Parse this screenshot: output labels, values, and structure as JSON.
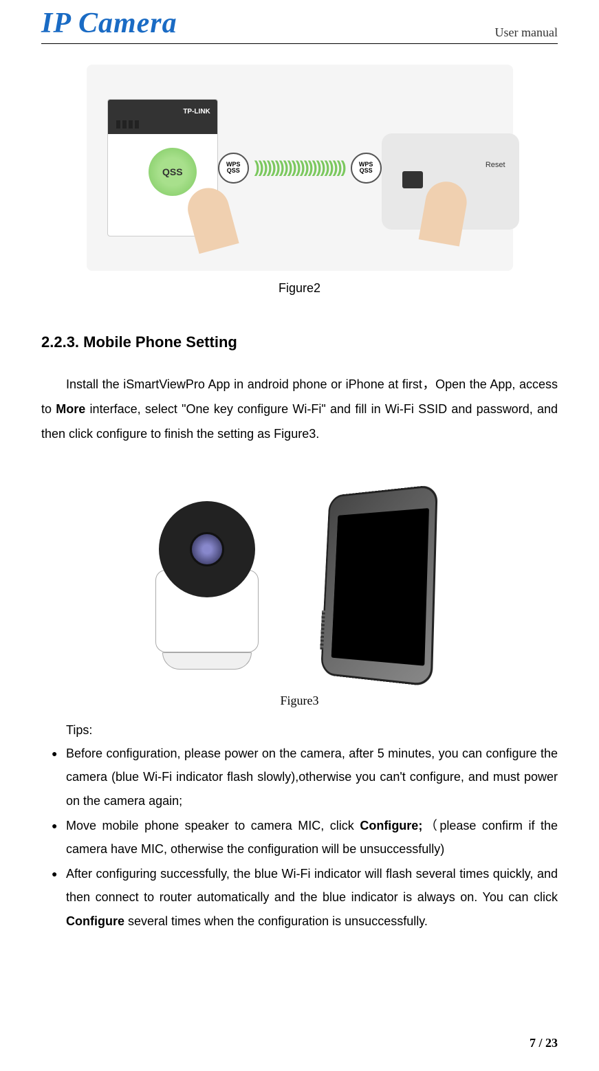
{
  "header": {
    "logo": "IP Camera",
    "right_text": "User manual"
  },
  "figure2": {
    "router_brand": "TP-LINK",
    "qss_label": "QSS",
    "wps_label_top": "WPS",
    "wps_label_bottom": "QSS",
    "reset_label": "Reset",
    "caption": "Figure2"
  },
  "section": {
    "heading": "2.2.3.  Mobile Phone Setting",
    "para_prefix": "Install the iSmartViewPro App in android phone or iPhone at first，Open the App, access to ",
    "para_bold": "More",
    "para_suffix": " interface, select \"One key configure Wi-Fi\" and fill in Wi-Fi SSID and password, and then click configure to finish the setting as Figure3."
  },
  "figure3": {
    "caption": "Figure3"
  },
  "tips": {
    "label": "Tips:",
    "items": [
      {
        "text": "Before configuration, please power on the camera, after 5 minutes, you can configure the camera (blue Wi-Fi indicator flash slowly),otherwise you can't configure, and must power on the camera again;"
      },
      {
        "prefix": "Move mobile phone speaker to camera MIC, click ",
        "bold": "Configure;",
        "suffix": "（please confirm if the camera have MIC, otherwise the configuration will be unsuccessfully)"
      },
      {
        "prefix": "After configuring successfully, the blue Wi-Fi indicator will flash several times quickly, and then connect to router automatically and the blue indicator is always on. You can click ",
        "bold": "Configure",
        "suffix": " several times when the configuration is unsuccessfully."
      }
    ]
  },
  "footer": {
    "page": "7 / 23"
  }
}
